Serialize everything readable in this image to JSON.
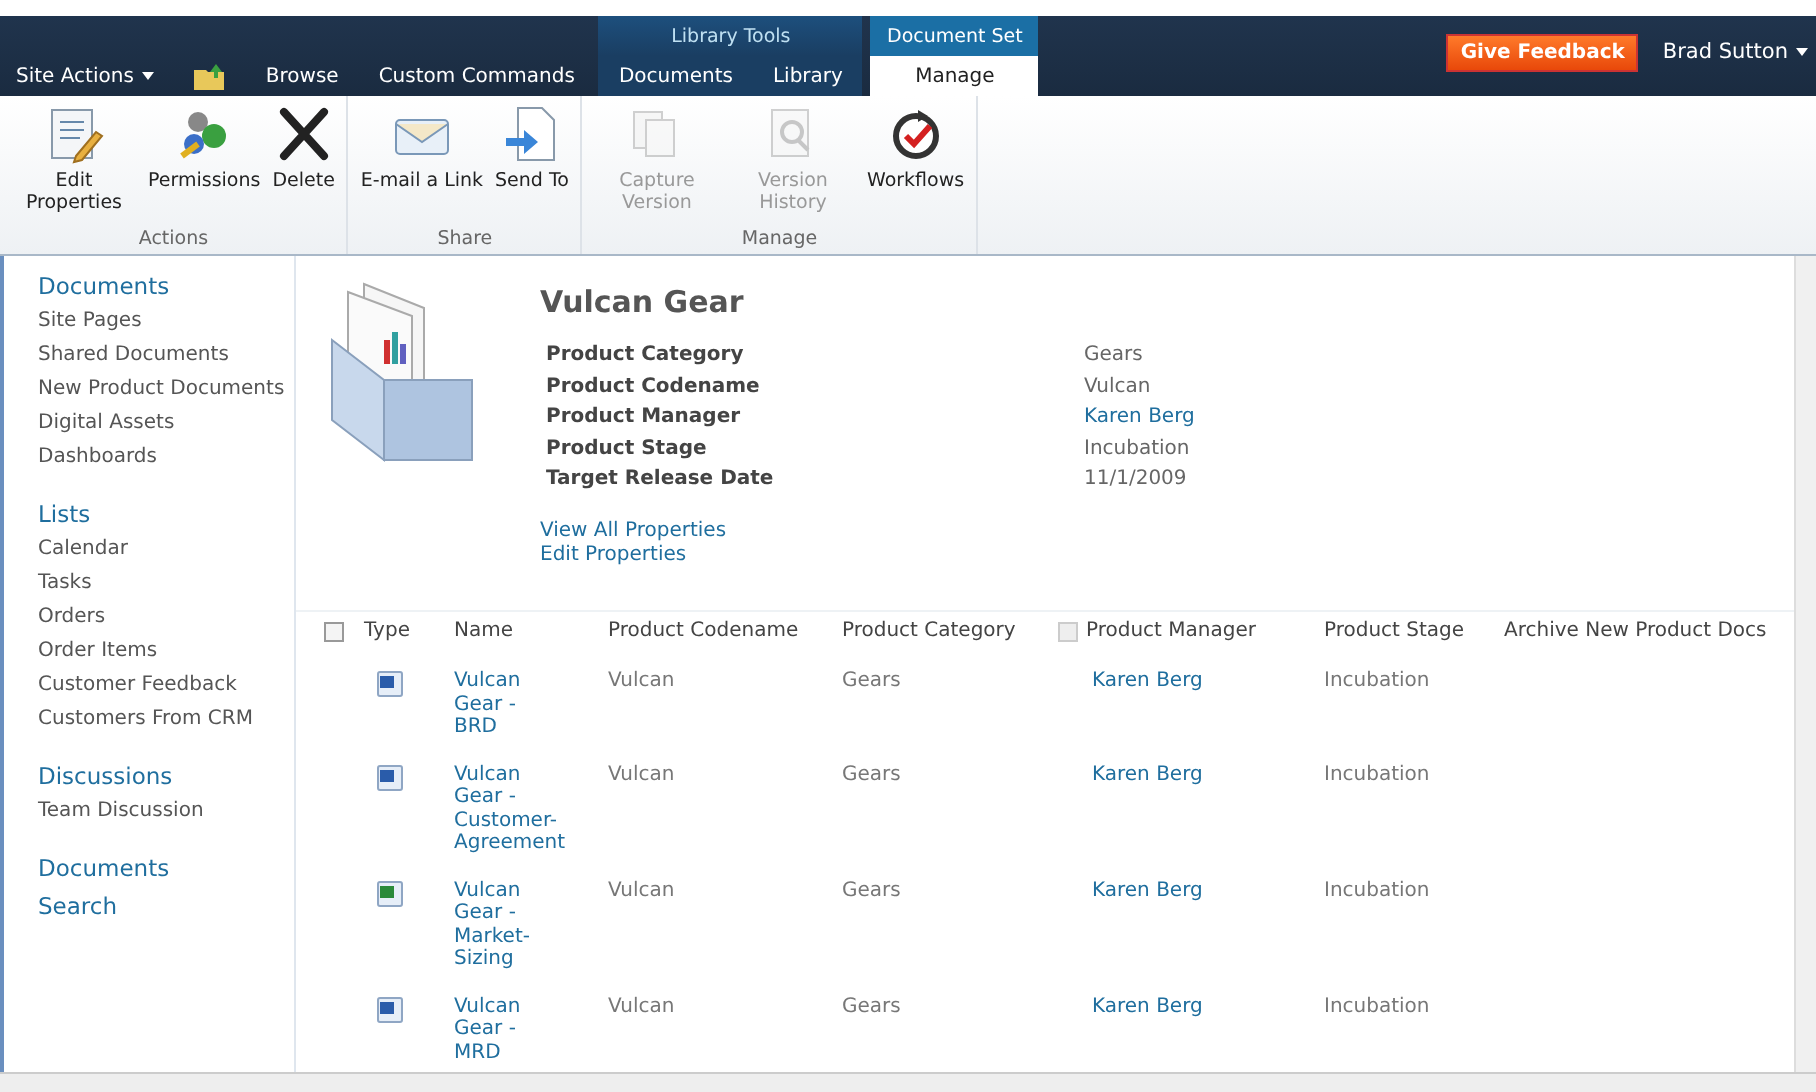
{
  "top_bar": {
    "tabs": [
      {
        "label": "Site Actions",
        "kind": "menu",
        "selected": false
      },
      {
        "kind": "icon",
        "selected": false
      },
      {
        "label": "Browse",
        "kind": "tab",
        "selected": false
      },
      {
        "label": "Custom Commands",
        "kind": "tab",
        "selected": false
      }
    ],
    "contextual_groups": [
      {
        "label": "Library Tools",
        "tabs": [
          {
            "label": "Documents",
            "selected": false
          },
          {
            "label": "Library",
            "selected": false
          }
        ]
      },
      {
        "label": "Document Set",
        "tabs": [
          {
            "label": "Manage",
            "selected": true
          }
        ]
      }
    ],
    "feedback_button": "Give Feedback",
    "user_menu": "Brad Sutton"
  },
  "ribbon": {
    "groups": [
      {
        "label": "Actions",
        "buttons": [
          {
            "label": "Edit Properties",
            "disabled": false
          },
          {
            "label": "Permissions",
            "disabled": false
          },
          {
            "label": "Delete",
            "disabled": false
          }
        ]
      },
      {
        "label": "Share",
        "buttons": [
          {
            "label": "E-mail a Link",
            "disabled": false
          },
          {
            "label": "Send To",
            "disabled": false
          }
        ]
      },
      {
        "label": "Manage",
        "buttons": [
          {
            "label": "Capture Version",
            "disabled": true
          },
          {
            "label": "Version History",
            "disabled": true
          },
          {
            "label": "Workflows",
            "disabled": false
          }
        ]
      }
    ]
  },
  "sidebar": {
    "sections": [
      {
        "heading": "Documents",
        "items": [
          "Site Pages",
          "Shared Documents",
          "New Product Documents",
          "Digital Assets",
          "Dashboards"
        ]
      },
      {
        "heading": "Lists",
        "items": [
          "Calendar",
          "Tasks",
          "Orders",
          "Order Items",
          "Customer Feedback",
          "Customers From CRM"
        ]
      },
      {
        "heading": "Discussions",
        "items": [
          "Team Discussion"
        ]
      },
      {
        "heading": "Documents"
      },
      {
        "heading": "Search"
      }
    ]
  },
  "document_set": {
    "title": "Vulcan Gear",
    "properties": [
      {
        "label": "Product Category",
        "value": "Gears",
        "kind": "text"
      },
      {
        "label": "Product Codename",
        "value": "Vulcan",
        "kind": "text"
      },
      {
        "label": "Product Manager",
        "value": "Karen Berg",
        "kind": "link"
      },
      {
        "label": "Product Stage",
        "value": "Incubation",
        "kind": "text"
      },
      {
        "label": "Target Release Date",
        "value": "11/1/2009",
        "kind": "text"
      }
    ],
    "links": [
      "View All Properties",
      "Edit Properties"
    ]
  },
  "table": {
    "select_all": {
      "checked": false
    },
    "columns": [
      {
        "label": "Type"
      },
      {
        "label": "Name"
      },
      {
        "label": "Product Codename"
      },
      {
        "label": "Product Category"
      },
      {
        "label": "Product Manager",
        "checkbox": {
          "checked": false,
          "disabled": true
        }
      },
      {
        "label": "Product Stage"
      },
      {
        "label": "Archive New Product Docs"
      }
    ],
    "rows": [
      {
        "kind": "word",
        "name": "Vulcan Gear - BRD",
        "codename": "Vulcan",
        "category": "Gears",
        "manager": "Karen Berg",
        "stage": "Incubation"
      },
      {
        "kind": "word",
        "name": "Vulcan Gear - Customer-Agreement",
        "codename": "Vulcan",
        "category": "Gears",
        "manager": "Karen Berg",
        "stage": "Incubation"
      },
      {
        "kind": "excel",
        "name": "Vulcan Gear - Market-Sizing",
        "codename": "Vulcan",
        "category": "Gears",
        "manager": "Karen Berg",
        "stage": "Incubation"
      },
      {
        "kind": "word",
        "name": "Vulcan Gear - MRD",
        "codename": "Vulcan",
        "category": "Gears",
        "manager": "Karen Berg",
        "stage": "Incubation"
      }
    ]
  }
}
